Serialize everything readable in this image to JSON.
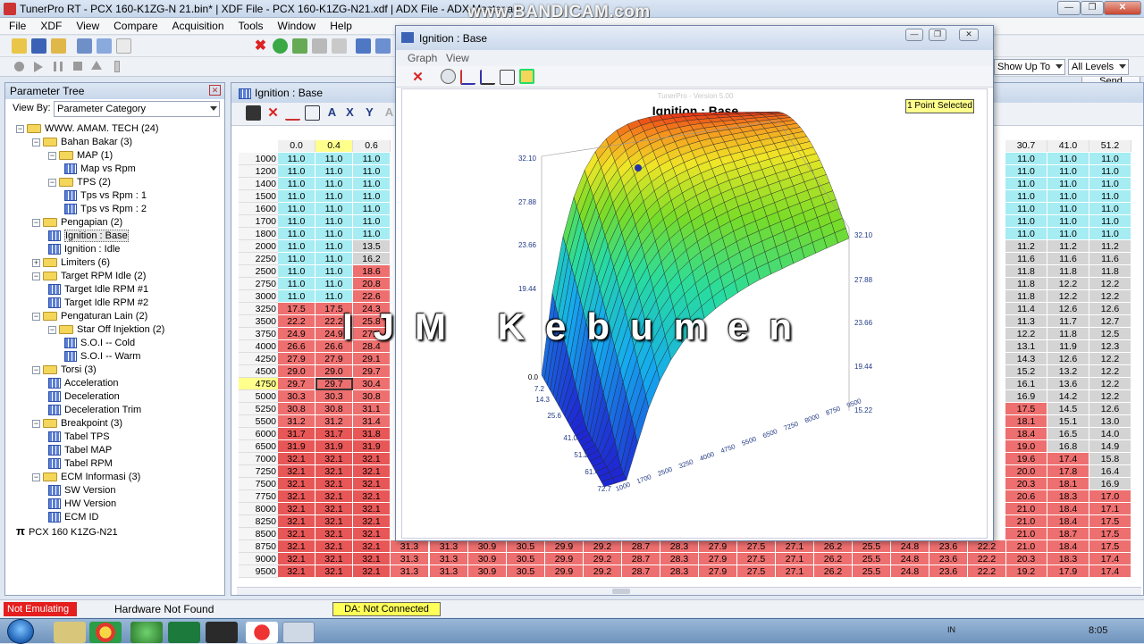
{
  "window": {
    "title": "TunerPro RT - PCX 160-K1ZG-N 21.bin* | XDF File - PCX 160-K1ZG-N21.xdf | ADX File - ADX Master.adx",
    "overlay_watermark": "www.BANDICAM.com"
  },
  "menu": [
    "File",
    "XDF",
    "View",
    "Compare",
    "Acquisition",
    "Tools",
    "Window",
    "Help"
  ],
  "toolbar": {
    "send_label": "Send",
    "show_up_to": "Show Up To",
    "all_levels": "All Levels"
  },
  "param_tree": {
    "title": "Parameter Tree",
    "view_by_label": "View By:",
    "view_by_value": "Parameter Category",
    "nodes": [
      {
        "label": "WWW. AMAM. TECH (24)",
        "type": "folder",
        "expanded": true
      },
      {
        "label": "Bahan Bakar (3)",
        "type": "folder",
        "expanded": true
      },
      {
        "label": "MAP (1)",
        "type": "folder",
        "expanded": true
      },
      {
        "label": "Map vs Rpm",
        "type": "table"
      },
      {
        "label": "TPS (2)",
        "type": "folder",
        "expanded": true
      },
      {
        "label": "Tps vs Rpm  : 1",
        "type": "table"
      },
      {
        "label": "Tps vs Rpm  : 2",
        "type": "table"
      },
      {
        "label": "Pengapian (2)",
        "type": "folder",
        "expanded": true
      },
      {
        "label": "Ignition : Base",
        "type": "table"
      },
      {
        "label": "Ignition : Idle",
        "type": "table"
      },
      {
        "label": "Limiters (6)",
        "type": "folder",
        "expanded": false
      },
      {
        "label": "Target RPM Idle (2)",
        "type": "folder",
        "expanded": true
      },
      {
        "label": "Target Idle RPM #1",
        "type": "table"
      },
      {
        "label": "Target Idle RPM #2",
        "type": "table"
      },
      {
        "label": "Pengaturan Lain (2)",
        "type": "folder",
        "expanded": true
      },
      {
        "label": "Star Off Injektion (2)",
        "type": "folder",
        "expanded": true
      },
      {
        "label": "S.O.I -- Cold",
        "type": "table"
      },
      {
        "label": "S.O.I -- Warm",
        "type": "table"
      },
      {
        "label": "Torsi (3)",
        "type": "folder",
        "expanded": true
      },
      {
        "label": "Acceleration",
        "type": "table"
      },
      {
        "label": "Deceleration",
        "type": "table"
      },
      {
        "label": "Deceleration Trim",
        "type": "table"
      },
      {
        "label": "Breakpoint (3)",
        "type": "folder",
        "expanded": true
      },
      {
        "label": "Tabel TPS",
        "type": "table"
      },
      {
        "label": "Tabel MAP",
        "type": "table"
      },
      {
        "label": "Tabel RPM",
        "type": "table"
      },
      {
        "label": "ECM Informasi (3)",
        "type": "folder",
        "expanded": true
      },
      {
        "label": "SW Version",
        "type": "table"
      },
      {
        "label": "HW Version",
        "type": "table"
      },
      {
        "label": "ECM ID",
        "type": "table"
      },
      {
        "label": "PCX 160 K1ZG-N21",
        "type": "root"
      }
    ]
  },
  "table_window": {
    "title": "Ignition : Base",
    "left_columns": [
      "0.0",
      "0.4",
      "0.6"
    ],
    "right_columns": [
      "30.7",
      "41.0",
      "51.2"
    ],
    "rows": [
      {
        "rpm": "1000",
        "left": [
          "11.0",
          "11.0",
          "11.0"
        ],
        "right": [
          "11.0",
          "11.0",
          "11.0"
        ]
      },
      {
        "rpm": "1200",
        "left": [
          "11.0",
          "11.0",
          "11.0"
        ],
        "right": [
          "11.0",
          "11.0",
          "11.0"
        ]
      },
      {
        "rpm": "1400",
        "left": [
          "11.0",
          "11.0",
          "11.0"
        ],
        "right": [
          "11.0",
          "11.0",
          "11.0"
        ]
      },
      {
        "rpm": "1500",
        "left": [
          "11.0",
          "11.0",
          "11.0"
        ],
        "right": [
          "11.0",
          "11.0",
          "11.0"
        ]
      },
      {
        "rpm": "1600",
        "left": [
          "11.0",
          "11.0",
          "11.0"
        ],
        "right": [
          "11.0",
          "11.0",
          "11.0"
        ]
      },
      {
        "rpm": "1700",
        "left": [
          "11.0",
          "11.0",
          "11.0"
        ],
        "right": [
          "11.0",
          "11.0",
          "11.0"
        ]
      },
      {
        "rpm": "1800",
        "left": [
          "11.0",
          "11.0",
          "11.0"
        ],
        "right": [
          "11.0",
          "11.0",
          "11.0"
        ]
      },
      {
        "rpm": "2000",
        "left": [
          "11.0",
          "11.0",
          "13.5"
        ],
        "right": [
          "11.2",
          "11.2",
          "11.2"
        ]
      },
      {
        "rpm": "2250",
        "left": [
          "11.0",
          "11.0",
          "16.2"
        ],
        "right": [
          "11.6",
          "11.6",
          "11.6"
        ]
      },
      {
        "rpm": "2500",
        "left": [
          "11.0",
          "11.0",
          "18.6"
        ],
        "right": [
          "11.8",
          "11.8",
          "11.8"
        ]
      },
      {
        "rpm": "2750",
        "left": [
          "11.0",
          "11.0",
          "20.8"
        ],
        "right": [
          "11.8",
          "12.2",
          "12.2"
        ]
      },
      {
        "rpm": "3000",
        "left": [
          "11.0",
          "11.0",
          "22.6"
        ],
        "right": [
          "11.8",
          "12.2",
          "12.2"
        ]
      },
      {
        "rpm": "3250",
        "left": [
          "17.5",
          "17.5",
          "24.3"
        ],
        "right": [
          "11.4",
          "12.6",
          "12.6"
        ]
      },
      {
        "rpm": "3500",
        "left": [
          "22.2",
          "22.2",
          "25.8"
        ],
        "right": [
          "11.3",
          "11.7",
          "12.7"
        ]
      },
      {
        "rpm": "3750",
        "left": [
          "24.9",
          "24.9",
          "27.4"
        ],
        "right": [
          "12.2",
          "11.8",
          "12.5"
        ]
      },
      {
        "rpm": "4000",
        "left": [
          "26.6",
          "26.6",
          "28.4"
        ],
        "right": [
          "13.1",
          "11.9",
          "12.3"
        ]
      },
      {
        "rpm": "4250",
        "left": [
          "27.9",
          "27.9",
          "29.1"
        ],
        "right": [
          "14.3",
          "12.6",
          "12.2"
        ]
      },
      {
        "rpm": "4500",
        "left": [
          "29.0",
          "29.0",
          "29.7"
        ],
        "right": [
          "15.2",
          "13.2",
          "12.2"
        ]
      },
      {
        "rpm": "4750",
        "left": [
          "29.7",
          "29.7",
          "30.4"
        ],
        "right": [
          "16.1",
          "13.6",
          "12.2"
        ]
      },
      {
        "rpm": "5000",
        "left": [
          "30.3",
          "30.3",
          "30.8"
        ],
        "right": [
          "16.9",
          "14.2",
          "12.2"
        ]
      },
      {
        "rpm": "5250",
        "left": [
          "30.8",
          "30.8",
          "31.1"
        ],
        "right": [
          "17.5",
          "14.5",
          "12.6"
        ]
      },
      {
        "rpm": "5500",
        "left": [
          "31.2",
          "31.2",
          "31.4"
        ],
        "right": [
          "18.1",
          "15.1",
          "13.0"
        ]
      },
      {
        "rpm": "6000",
        "left": [
          "31.7",
          "31.7",
          "31.8"
        ],
        "right": [
          "18.4",
          "16.5",
          "14.0"
        ]
      },
      {
        "rpm": "6500",
        "left": [
          "31.9",
          "31.9",
          "31.9"
        ],
        "right": [
          "19.0",
          "16.8",
          "14.9"
        ]
      },
      {
        "rpm": "7000",
        "left": [
          "32.1",
          "32.1",
          "32.1"
        ],
        "right": [
          "19.6",
          "17.4",
          "15.8"
        ]
      },
      {
        "rpm": "7250",
        "left": [
          "32.1",
          "32.1",
          "32.1"
        ],
        "right": [
          "20.0",
          "17.8",
          "16.4"
        ]
      },
      {
        "rpm": "7500",
        "left": [
          "32.1",
          "32.1",
          "32.1"
        ],
        "right": [
          "20.3",
          "18.1",
          "16.9"
        ]
      },
      {
        "rpm": "7750",
        "left": [
          "32.1",
          "32.1",
          "32.1"
        ],
        "right": [
          "20.6",
          "18.3",
          "17.0"
        ]
      },
      {
        "rpm": "8000",
        "left": [
          "32.1",
          "32.1",
          "32.1"
        ],
        "right": [
          "21.0",
          "18.4",
          "17.1"
        ]
      },
      {
        "rpm": "8250",
        "left": [
          "32.1",
          "32.1",
          "32.1"
        ],
        "right": [
          "21.0",
          "18.4",
          "17.5"
        ]
      },
      {
        "rpm": "8500",
        "left": [
          "32.1",
          "32.1",
          "32.1"
        ],
        "right": [
          "21.0",
          "18.7",
          "17.5"
        ]
      },
      {
        "rpm": "8750",
        "left": [
          "32.1",
          "32.1",
          "32.1"
        ],
        "right": [
          "21.0",
          "18.4",
          "17.5"
        ]
      },
      {
        "rpm": "9000",
        "left": [
          "32.1",
          "32.1",
          "32.1"
        ],
        "right": [
          "20.3",
          "18.3",
          "17.4"
        ]
      },
      {
        "rpm": "9500",
        "left": [
          "32.1",
          "32.1",
          "32.1"
        ],
        "right": [
          "19.2",
          "17.9",
          "17.4"
        ]
      }
    ],
    "bottom_visible_rows": [
      {
        "rpm": "8750",
        "mid": [
          "31.3",
          "31.3",
          "30.9",
          "30.5",
          "29.9",
          "29.2",
          "28.7",
          "28.3",
          "27.9",
          "27.5",
          "27.1",
          "26.2",
          "25.5",
          "24.8",
          "23.6",
          "22.2"
        ]
      },
      {
        "rpm": "9000",
        "mid": [
          "31.3",
          "31.3",
          "30.9",
          "30.5",
          "29.9",
          "29.2",
          "28.7",
          "28.3",
          "27.9",
          "27.5",
          "27.1",
          "26.2",
          "25.5",
          "24.8",
          "23.6",
          "22.2"
        ]
      },
      {
        "rpm": "9500",
        "mid": [
          "31.3",
          "31.3",
          "30.9",
          "30.5",
          "29.9",
          "29.2",
          "28.7",
          "28.3",
          "27.9",
          "27.5",
          "27.1",
          "26.2",
          "25.5",
          "24.8",
          "23.6",
          "22.2"
        ]
      }
    ]
  },
  "graph_window": {
    "title": "Ignition : Base",
    "menu": [
      "Graph",
      "View"
    ],
    "version_text": "TunerPro - Version 5.00",
    "chart_title": "Ignition : Base",
    "selection_badge": "1 Point Selected",
    "watermark_text": "IJM Kebumen",
    "z_ticks_left": [
      "32.10",
      "27.88",
      "23.66",
      "19.44"
    ],
    "z_ticks_right": [
      "32.10",
      "27.88",
      "23.66",
      "19.44",
      "15.22"
    ],
    "y_ticks": [
      "0.0",
      "7.2",
      "14.3",
      "25.6",
      "41.0",
      "51.2",
      "61.4",
      "72.7"
    ],
    "x_ticks": [
      "1000",
      "1700",
      "2500",
      "3250",
      "4000",
      "4750",
      "5500",
      "6500",
      "7250",
      "8000",
      "8750",
      "9500"
    ]
  },
  "status": {
    "emulating": "Not Emulating",
    "hardware": "Hardware Not Found",
    "da": "DA: Not Connected"
  },
  "taskbar": {
    "clock": "8:05",
    "lang": "IN"
  },
  "colors": {
    "cell_cyan": "#a6ecf3",
    "cell_gray": "#d4d4d4",
    "cell_red": "#ee6f6f",
    "cell_red_dark": "#e85757",
    "highlight_yellow": "#ffff5a",
    "status_red": "#e51e1e"
  }
}
